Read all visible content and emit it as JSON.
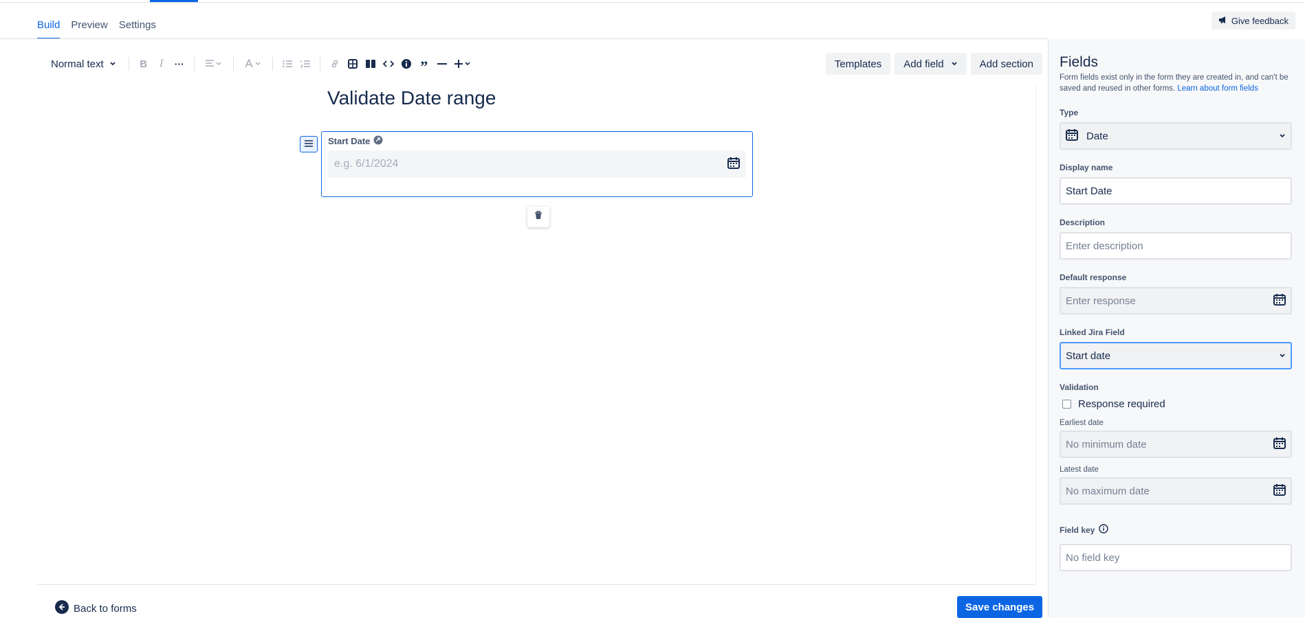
{
  "tabs": [
    {
      "label": "Build",
      "active": true
    },
    {
      "label": "Preview",
      "active": false
    },
    {
      "label": "Settings",
      "active": false
    }
  ],
  "feedback": {
    "label": "Give feedback"
  },
  "toolbar": {
    "text_style": "Normal text",
    "actions": {
      "templates": "Templates",
      "add_field": "Add field",
      "add_section": "Add section"
    }
  },
  "document": {
    "title": "Validate Date range",
    "field": {
      "label": "Start Date",
      "placeholder": "e.g. 6/1/2024"
    }
  },
  "footer": {
    "back": "Back to forms",
    "save": "Save changes"
  },
  "panel": {
    "title": "Fields",
    "description": "Form fields exist only in the form they are created in, and can't be saved and reused in other forms.",
    "learn_link": "Learn about form fields",
    "type_label": "Type",
    "type_value": "Date",
    "display_name_label": "Display name",
    "display_name_value": "Start Date",
    "description_label": "Description",
    "description_placeholder": "Enter description",
    "default_label": "Default response",
    "default_placeholder": "Enter response",
    "linked_label": "Linked Jira Field",
    "linked_value": "Start date",
    "validation_label": "Validation",
    "response_required": "Response required",
    "earliest_label": "Earliest date",
    "earliest_placeholder": "No minimum date",
    "latest_label": "Latest date",
    "latest_placeholder": "No maximum date",
    "field_key_label": "Field key",
    "field_key_placeholder": "No field key"
  },
  "colors": {
    "accent": "#0c66e4",
    "text": "#172b4d",
    "panel_bg": "#f7f8f9"
  }
}
